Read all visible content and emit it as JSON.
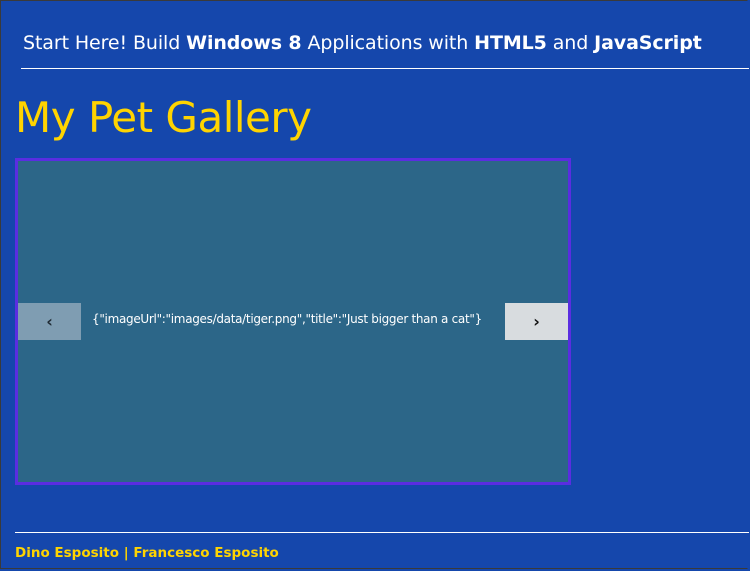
{
  "header": {
    "part1": "Start Here! Build ",
    "bold1": "Windows 8",
    "part2": " Applications with ",
    "bold2": "HTML5",
    "part3": " and ",
    "bold3": "JavaScript"
  },
  "page": {
    "title": "My Pet Gallery"
  },
  "gallery": {
    "prev_glyph": "‹",
    "next_glyph": "›",
    "current_item_text": "{\"imageUrl\":\"images/data/tiger.png\",\"title\":\"Just bigger than a cat\"}"
  },
  "footer": {
    "authors": "Dino Esposito | Francesco Esposito"
  },
  "colors": {
    "background": "#1547ac",
    "title": "#ffd400",
    "flipview_bg": "#2c6688",
    "flipview_border": "#5a2de1"
  },
  "icons": {
    "prev": "chevron-left-icon",
    "next": "chevron-right-icon"
  }
}
